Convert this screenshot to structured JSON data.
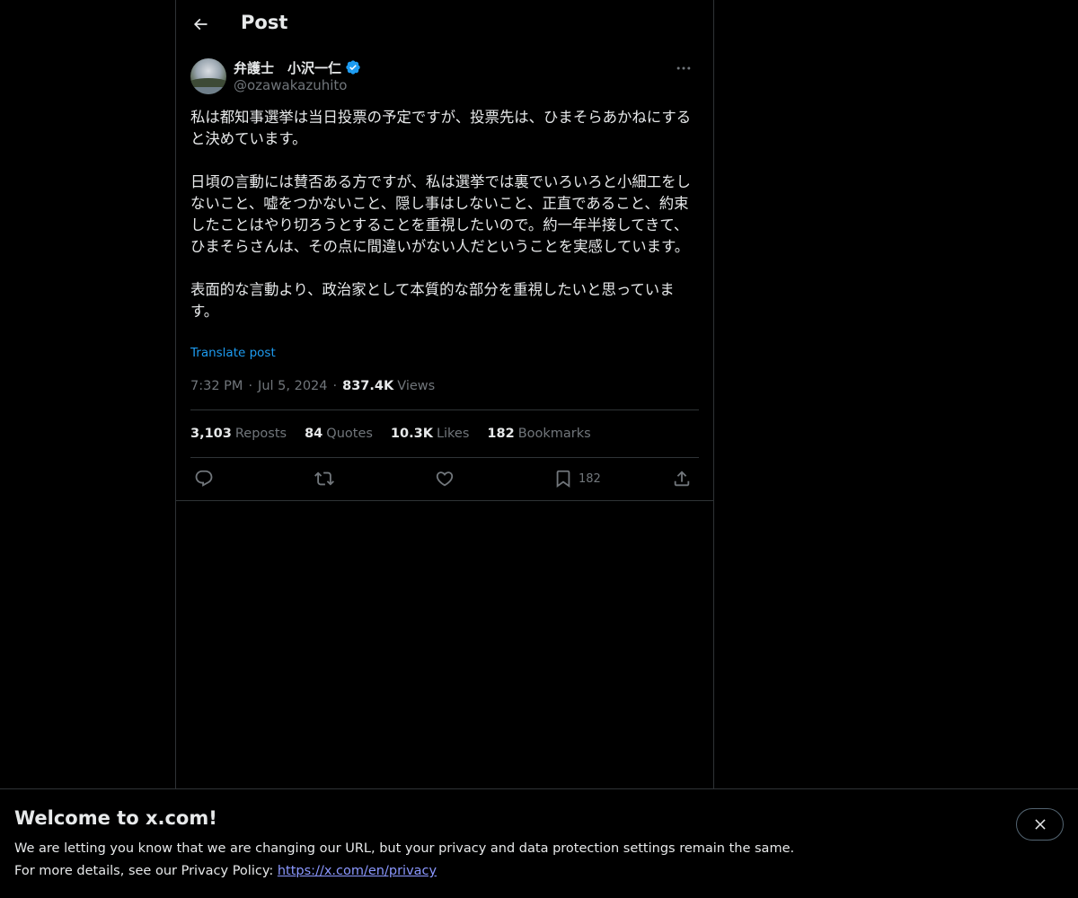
{
  "header": {
    "title": "Post",
    "back_icon": "arrow-left-icon"
  },
  "author": {
    "display_name": "弁護士　小沢一仁",
    "handle": "@ozawakazuhito",
    "verified": true,
    "verified_color": "#1d9bf0"
  },
  "post": {
    "text": "私は都知事選挙は当日投票の予定ですが、投票先は、ひまそらあかねにすると決めています。\n\n日頃の言動には賛否ある方ですが、私は選挙では裏でいろいろと小細工をしないこと、嘘をつかないこと、隠し事はしないこと、正直であること、約束したことはやり切ろうとすることを重視したいので。約一年半接してきて、ひまそらさんは、その点に間違いがない人だということを実感しています。\n\n表面的な言動より、政治家として本質的な部分を重視したいと思っています。",
    "translate_label": "Translate post",
    "time": "7:32 PM",
    "date": "Jul 5, 2024",
    "views_count": "837.4K",
    "views_label": "Views"
  },
  "stats": {
    "reposts": {
      "count": "3,103",
      "label": "Reposts"
    },
    "quotes": {
      "count": "84",
      "label": "Quotes"
    },
    "likes": {
      "count": "10.3K",
      "label": "Likes"
    },
    "bookmarks": {
      "count": "182",
      "label": "Bookmarks"
    }
  },
  "actions": {
    "reply_icon": "reply-icon",
    "repost_icon": "repost-icon",
    "like_icon": "heart-icon",
    "bookmark_icon": "bookmark-icon",
    "bookmark_count": "182",
    "share_icon": "share-icon"
  },
  "banner": {
    "title": "Welcome to x.com!",
    "line1": "We are letting you know that we are changing our URL, but your privacy and data protection settings remain the same.",
    "line2_prefix": "For more details, see our Privacy Policy: ",
    "link": "https://x.com/en/privacy",
    "close_icon": "close-icon"
  },
  "separator": "·"
}
